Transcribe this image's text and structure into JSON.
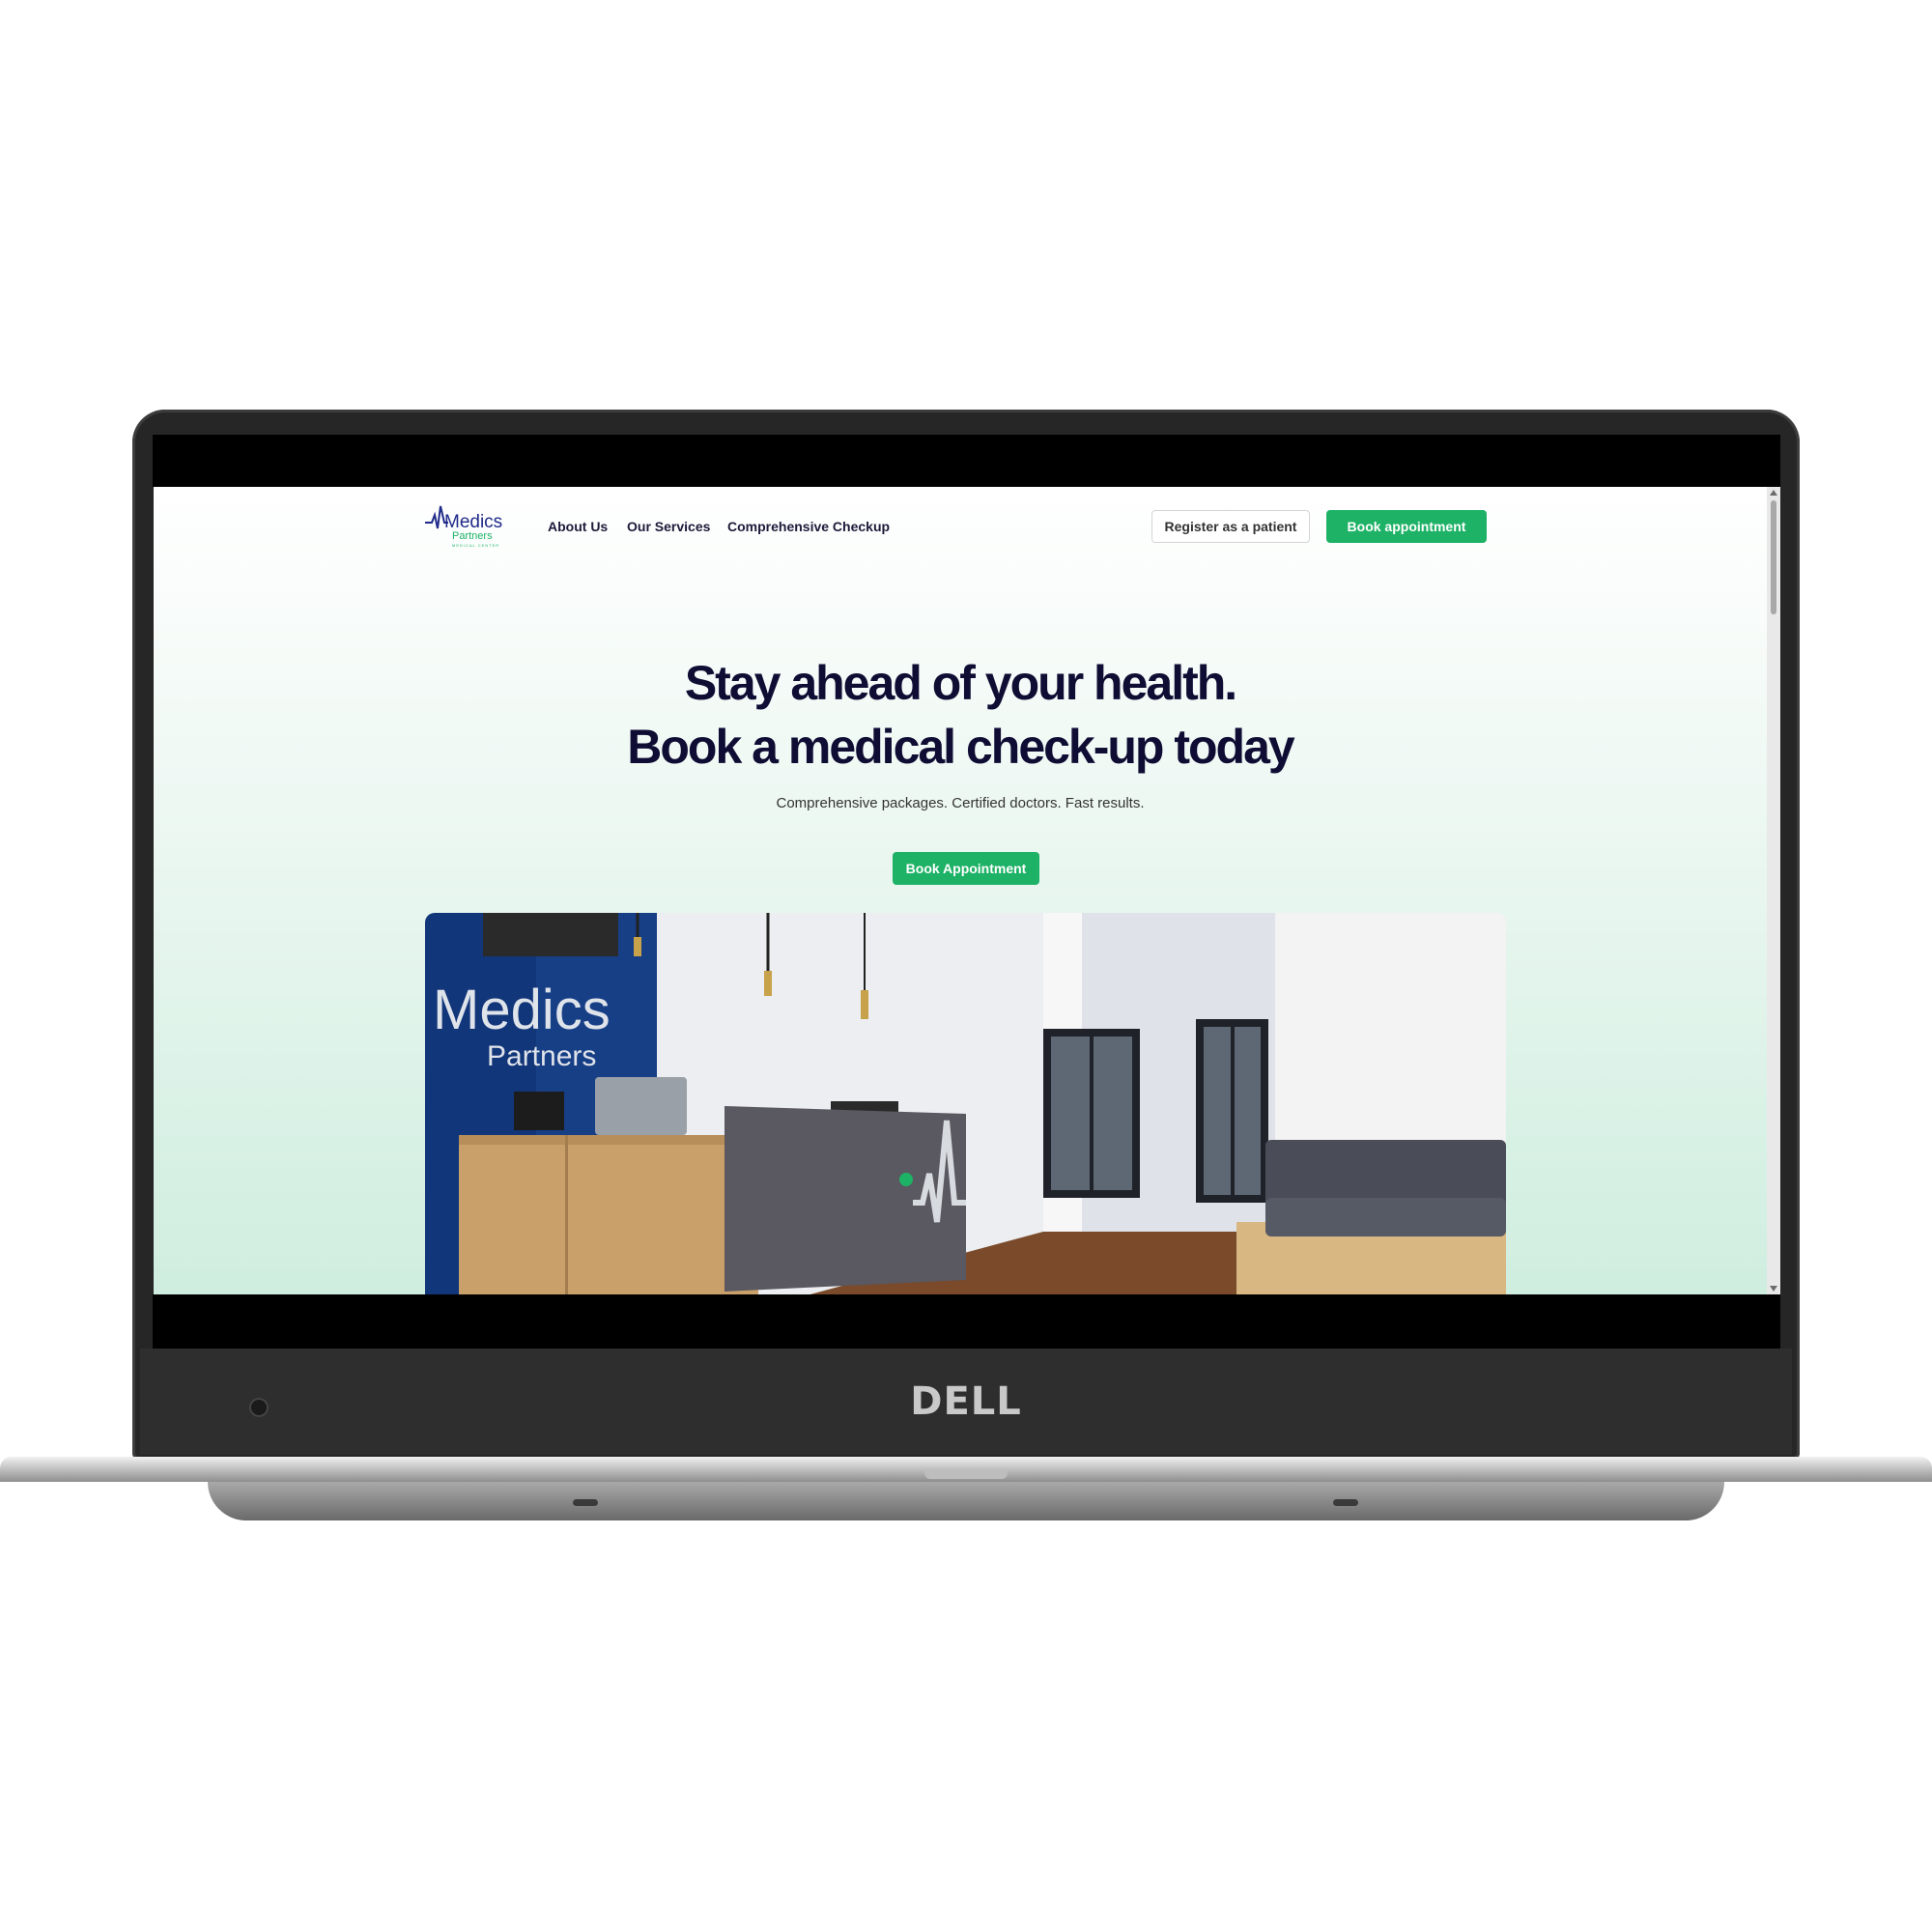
{
  "device": {
    "brand": "DELL"
  },
  "logo": {
    "line1": "Medics",
    "line2": "Partners",
    "line3": "MEDICAL CENTER"
  },
  "nav": {
    "links": [
      "About Us",
      "Our Services",
      "Comprehensive Checkup"
    ],
    "register_label": "Register as a patient",
    "book_label": "Book appointment"
  },
  "hero": {
    "title_line1": "Stay ahead of your health.",
    "title_line2": "Book a medical check-up today",
    "subtitle": "Comprehensive packages. Certified doctors. Fast results.",
    "cta_label": "Book Appointment"
  },
  "photo": {
    "sign_line1": "Medics",
    "sign_line2": "Partners"
  },
  "colors": {
    "accent": "#1db266",
    "heading": "#0f0d34",
    "logo_blue": "#1f2a8a",
    "logo_green": "#1db266",
    "wall_blue": "#12367a"
  }
}
